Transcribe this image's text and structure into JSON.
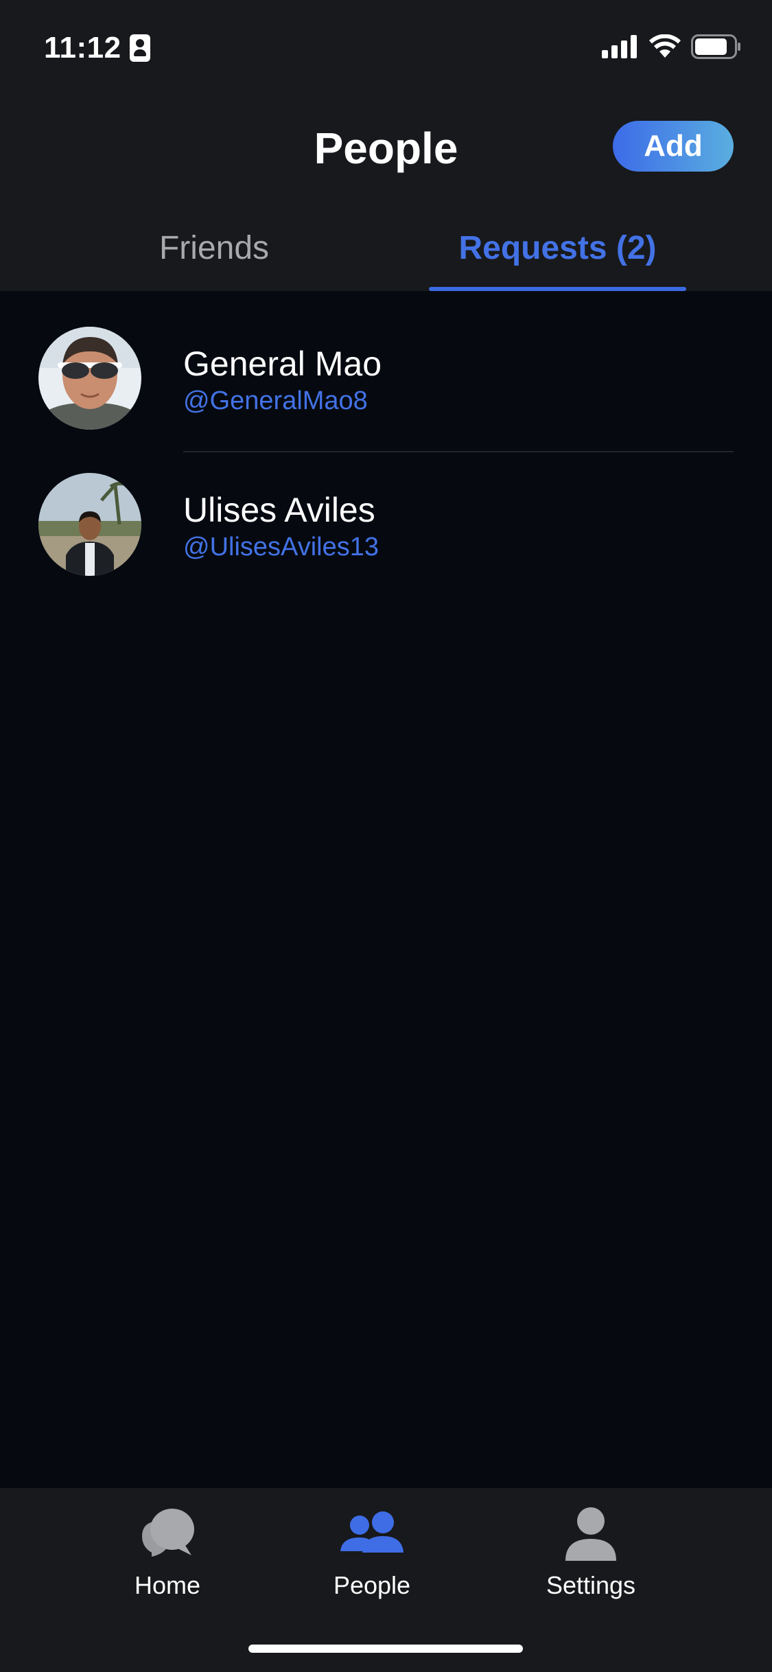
{
  "status_bar": {
    "time": "11:12"
  },
  "header": {
    "title": "People",
    "add_label": "Add"
  },
  "tabs": [
    {
      "label": "Friends",
      "active": false
    },
    {
      "label": "Requests (2)",
      "active": true
    }
  ],
  "requests": [
    {
      "name": "General Mao",
      "handle": "@GeneralMao8"
    },
    {
      "name": "Ulises Aviles",
      "handle": "@UlisesAviles13"
    }
  ],
  "tabbar": {
    "items": [
      {
        "label": "Home",
        "icon": "chat-bubbles-icon",
        "active": false
      },
      {
        "label": "People",
        "icon": "people-icon",
        "active": true
      },
      {
        "label": "Settings",
        "icon": "person-icon",
        "active": false
      }
    ]
  },
  "colors": {
    "accent": "#4372e6",
    "header_bg": "#18191c",
    "content_bg": "#060a10",
    "inactive_icon": "#a8a9ad"
  }
}
